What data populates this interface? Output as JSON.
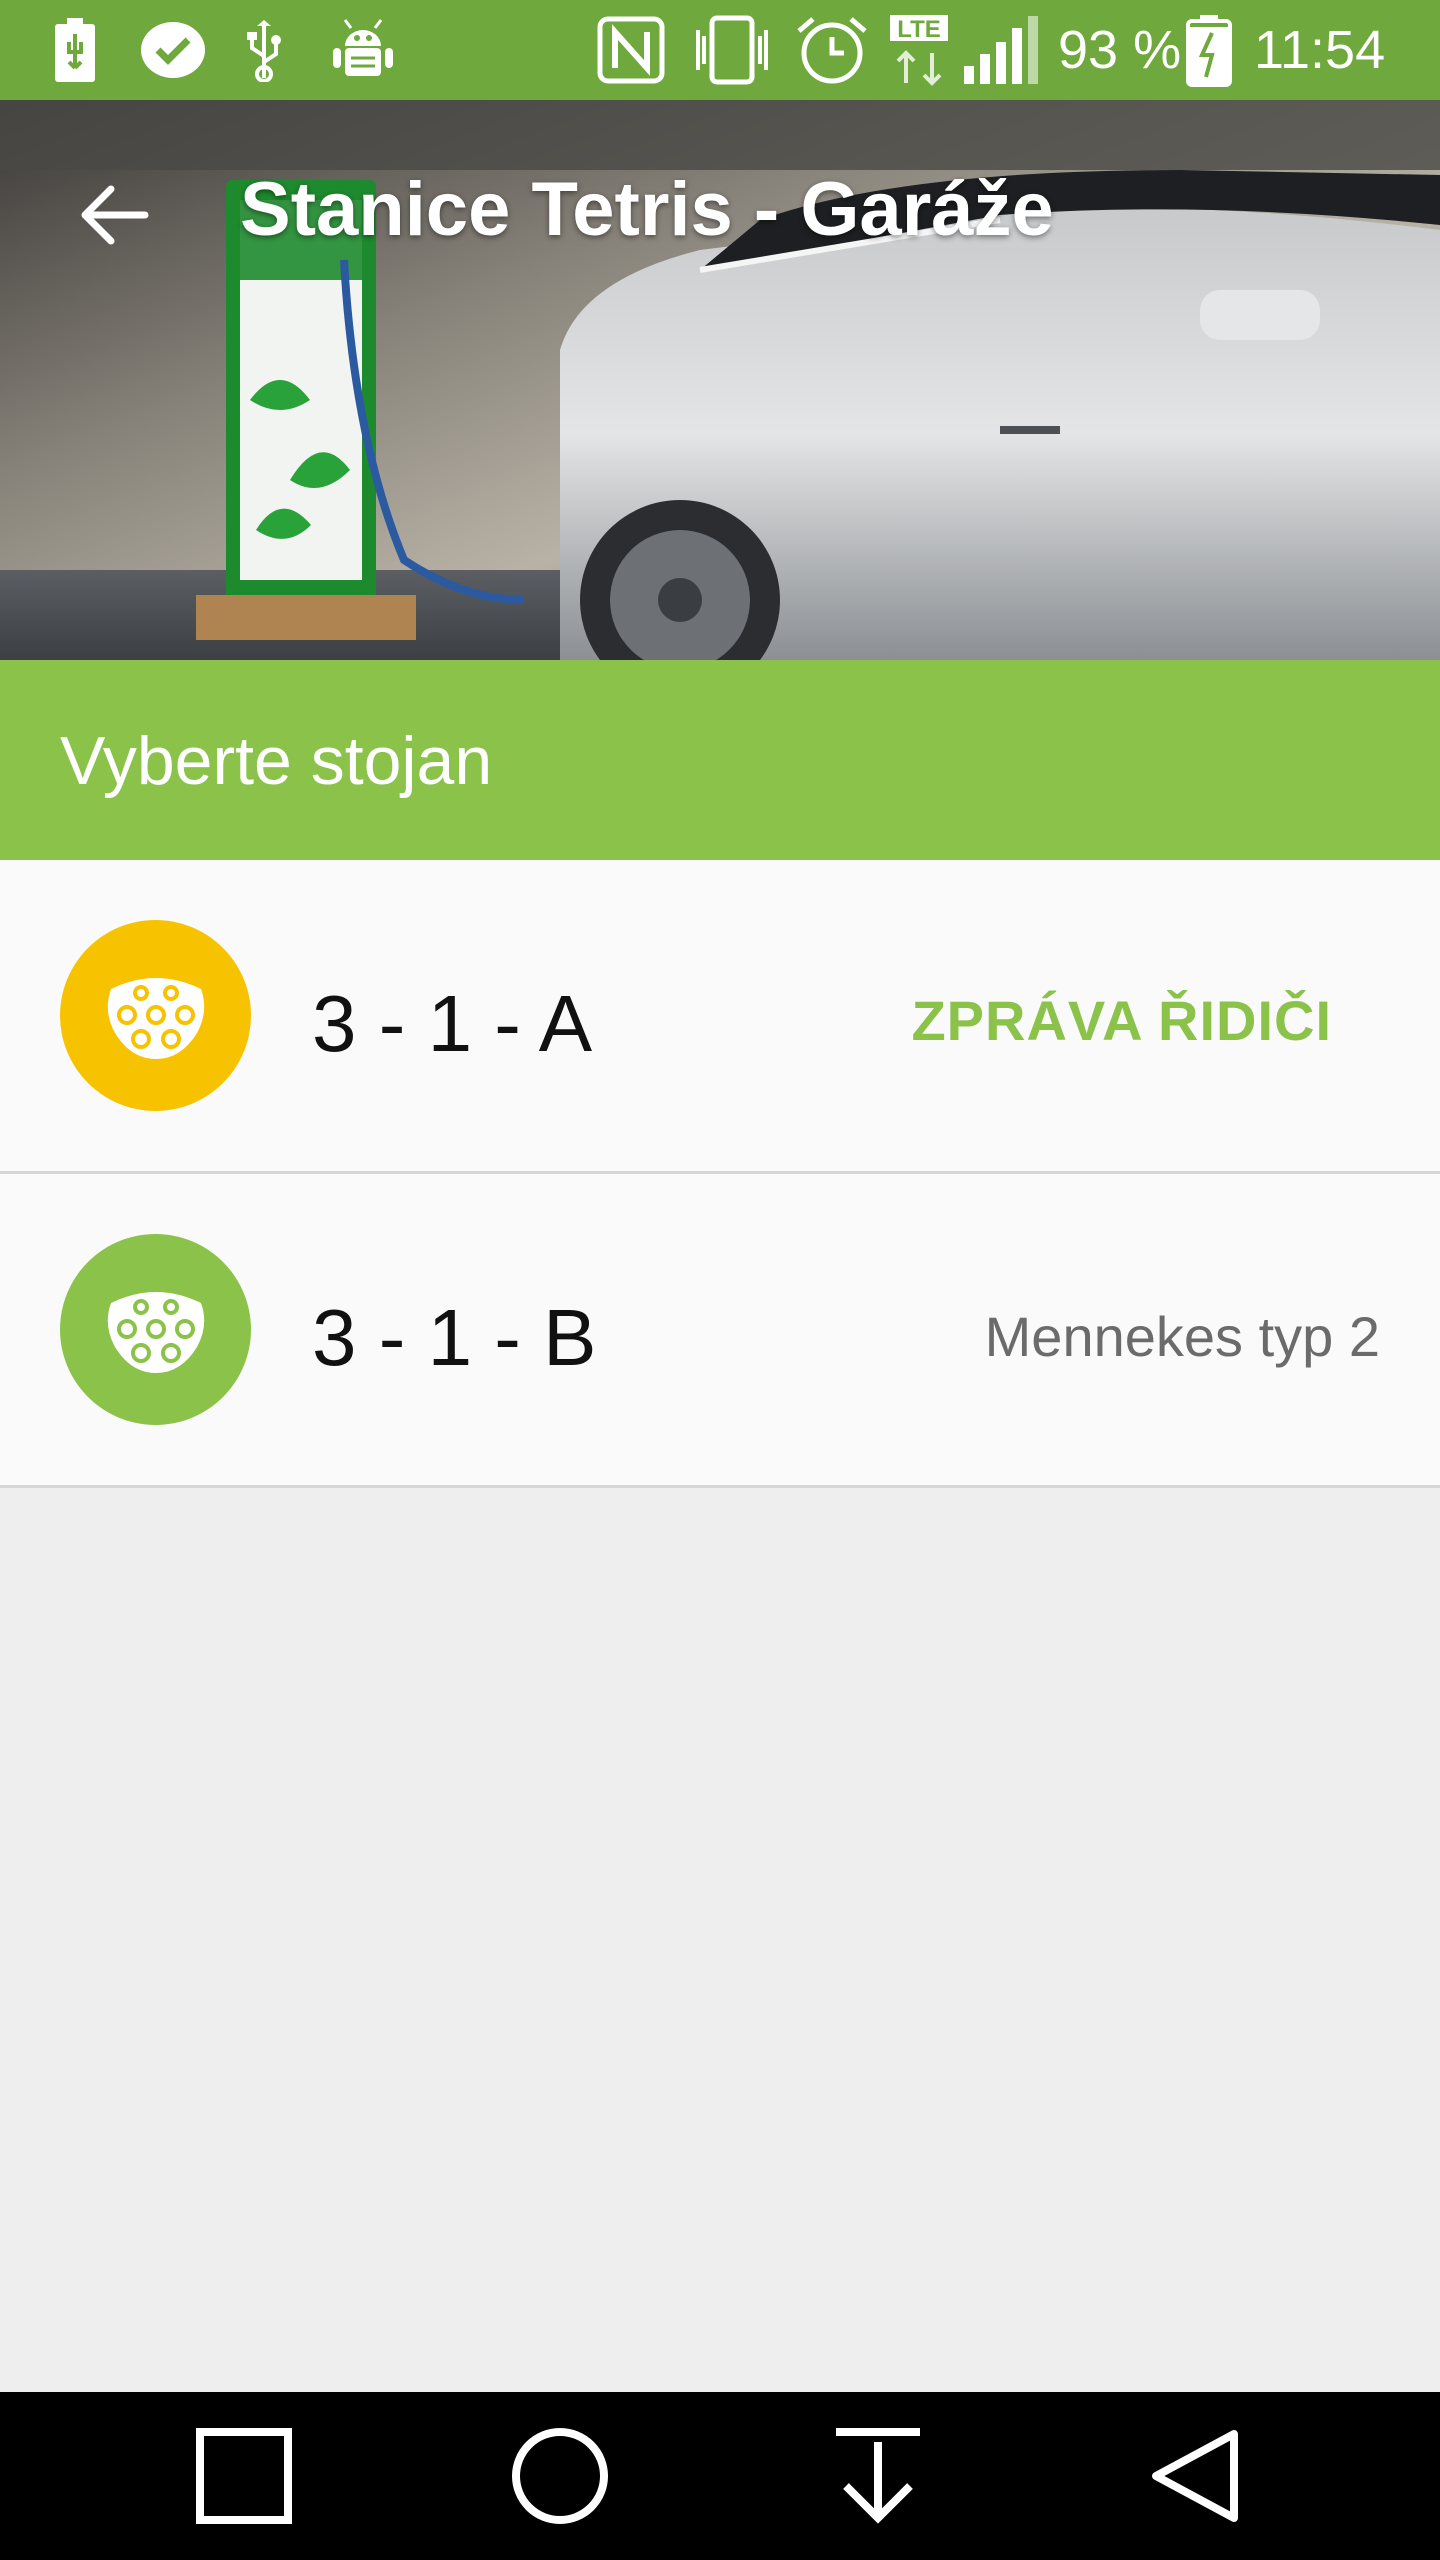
{
  "status_bar": {
    "battery_percent": "93 %",
    "time": "11:54",
    "left_icons": [
      "usb-battery-icon",
      "check-bubble-icon",
      "usb-icon",
      "android-debug-icon"
    ],
    "right_icons": [
      "nfc-icon",
      "vibrate-icon",
      "alarm-icon",
      "lte-icon",
      "signal-icon",
      "battery-charging-icon"
    ]
  },
  "header": {
    "title": "Stanice Tetris - Garáže",
    "back_icon": "arrow-back-icon"
  },
  "section": {
    "title": "Vyberte stojan"
  },
  "connectors": [
    {
      "label": "3 - 1 - A",
      "icon_color": "#f7c300",
      "action": "ZPRÁVA ŘIDIČI",
      "detail": ""
    },
    {
      "label": "3 - 1 - B",
      "icon_color": "#8bc34a",
      "action": "",
      "detail": "Mennekes typ 2"
    }
  ],
  "nav_bar": {
    "buttons": [
      "recents-square-icon",
      "home-circle-icon",
      "notifications-down-icon",
      "back-triangle-icon"
    ]
  },
  "colors": {
    "status_bar": "#6fa83c",
    "accent_green": "#8bc34a",
    "warning_yellow": "#f7c300",
    "background": "#eeeeee"
  }
}
